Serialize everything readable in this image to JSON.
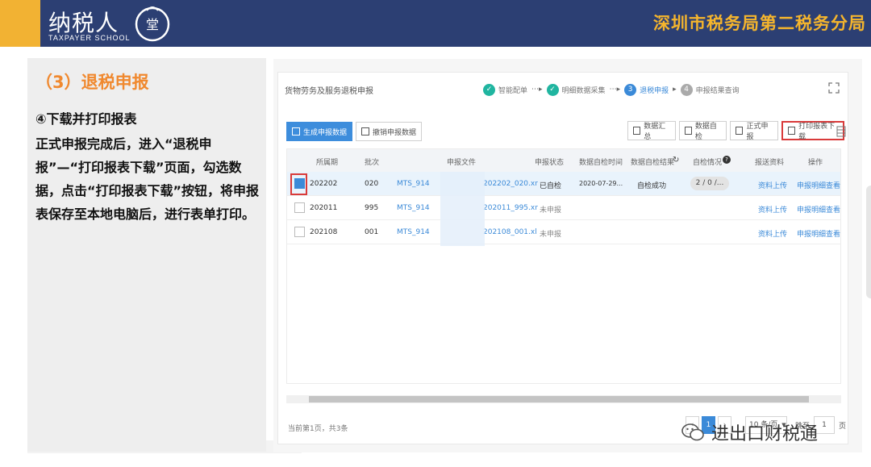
{
  "banner": {
    "logo_title": "纳税人",
    "logo_subtitle": "TAXPAYER SCHOOL",
    "logo_seal_text": "学堂",
    "org_name": "深圳市税务局第二税务分局",
    "colors": {
      "navy": "#2c3f73",
      "gold": "#f2b233"
    }
  },
  "left": {
    "section_title": "（3）退税申报",
    "step_title": "④下载并打印报表",
    "step_desc": "正式申报完成后，进入“退税申报”—“打印报表下载”页面，勾选数据，点击“打印报表下载”按钮，将申报表保存至本地电脑后，进行表单打印。"
  },
  "app": {
    "page_heading": "货物劳务及服务退税申报",
    "steps": [
      {
        "label": "智能配单",
        "state": "done"
      },
      {
        "label": "明细数据采集",
        "state": "done"
      },
      {
        "label": "退税申报",
        "state": "current",
        "number": "3"
      },
      {
        "label": "申报结果查询",
        "state": "todo",
        "number": "4"
      }
    ],
    "toolbar_left": [
      "生成申报数据",
      "撤销申报数据"
    ],
    "toolbar_right": [
      "数据汇总",
      "数据自检",
      "正式申报",
      "打印报表下载"
    ],
    "table": {
      "headers": [
        "所属期",
        "批次",
        "申报文件",
        "申报状态",
        "数据自检时间",
        "数据自检结果",
        "自检情况",
        "报送资料",
        "操作"
      ],
      "rows": [
        {
          "period": "202202",
          "batch": "020",
          "file_prefix": "MTS_914",
          "file_name": "202202_020.xr",
          "status": "已自检",
          "check_time": "2020-07-29...",
          "check_result": "自检成功",
          "check_stats": "2 / 0 /...",
          "submit": "资料上传",
          "action": "申报明细查看",
          "checked": true
        },
        {
          "period": "202011",
          "batch": "995",
          "file_prefix": "MTS_914",
          "file_name": "202011_995.xr",
          "status": "未申报",
          "check_time": "",
          "check_result": "",
          "check_stats": "",
          "submit": "资料上传",
          "action": "申报明细查看",
          "checked": false
        },
        {
          "period": "202108",
          "batch": "001",
          "file_prefix": "MTS_914",
          "file_name": "202108_001.xl",
          "status": "未申报",
          "check_time": "",
          "check_result": "",
          "check_stats": "",
          "submit": "资料上传",
          "action": "申报明细查看",
          "checked": false
        }
      ]
    },
    "footer": {
      "count_text": "当前第1页，共3条",
      "current_page": "1",
      "page_size": "10 条/页",
      "goto_label": "跳至",
      "goto_value": "1",
      "page_unit": "页"
    }
  },
  "watermark": {
    "text": "进出口财税通",
    "icon": "wechat-icon"
  }
}
